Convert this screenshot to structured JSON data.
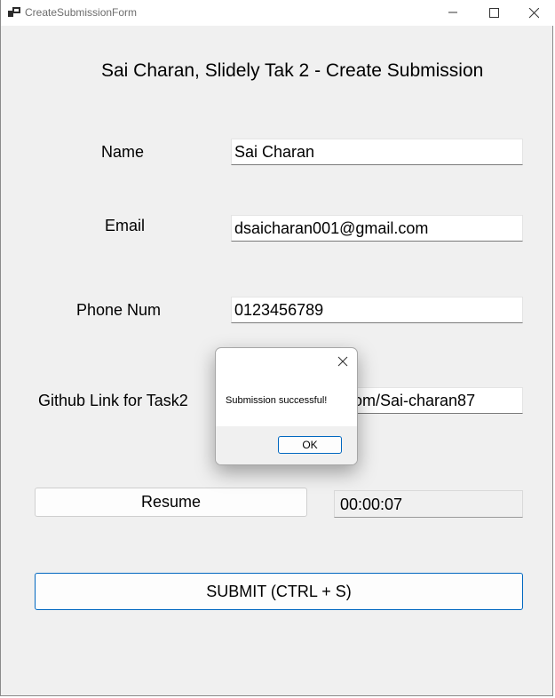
{
  "window": {
    "title": "CreateSubmissionForm"
  },
  "form": {
    "heading": "Sai Charan, Slidely Tak 2 - Create Submission",
    "name_label": "Name",
    "name_value": "Sai Charan",
    "email_label": "Email",
    "email_value": "dsaicharan001@gmail.com",
    "phone_label": "Phone Num",
    "phone_value": "0123456789",
    "github_label": "Github Link for Task2",
    "github_value_visible": "om/Sai-charan87",
    "resume_label": "Resume",
    "timer_value": "00:00:07",
    "submit_label": "SUBMIT (CTRL + S)"
  },
  "dialog": {
    "message": "Submission successful!",
    "ok_label": "OK"
  },
  "colors": {
    "window_bg": "#f0f0f0",
    "accent": "#0067c0"
  },
  "icons": {
    "app": "form-app-icon",
    "minimize": "minimize-icon",
    "maximize": "maximize-icon",
    "close": "close-icon",
    "dialog_close": "close-icon"
  }
}
